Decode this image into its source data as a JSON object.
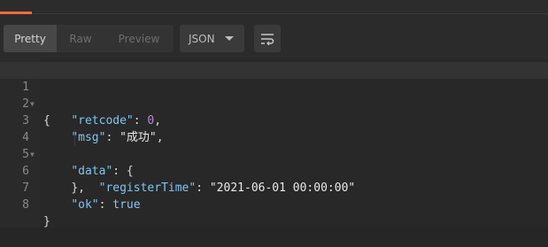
{
  "toolbar": {
    "view_tabs": [
      {
        "label": "Pretty",
        "active": true
      },
      {
        "label": "Raw",
        "active": false
      },
      {
        "label": "Preview",
        "active": false
      }
    ],
    "format": "JSON",
    "wrap_icon": "wrap-lines-icon"
  },
  "editor": {
    "lines": [
      {
        "number": "1",
        "foldable": true
      },
      {
        "number": "2",
        "key": "\"retcode\"",
        "value": "0"
      },
      {
        "number": "3",
        "key": "\"msg\"",
        "value": "\"成功\""
      },
      {
        "number": "4",
        "key": "\"data\"",
        "foldable": true
      },
      {
        "number": "5",
        "key": "\"registerTime\"",
        "value": "\"2021-06-01 00:00:00\""
      },
      {
        "number": "6"
      },
      {
        "number": "7",
        "key": "\"ok\"",
        "value": "true"
      },
      {
        "number": "8"
      }
    ]
  },
  "colors": {
    "accent": "#f26b3a",
    "key": "#7fc5f2",
    "number": "#b987d8",
    "boolean": "#8fc3f0"
  }
}
